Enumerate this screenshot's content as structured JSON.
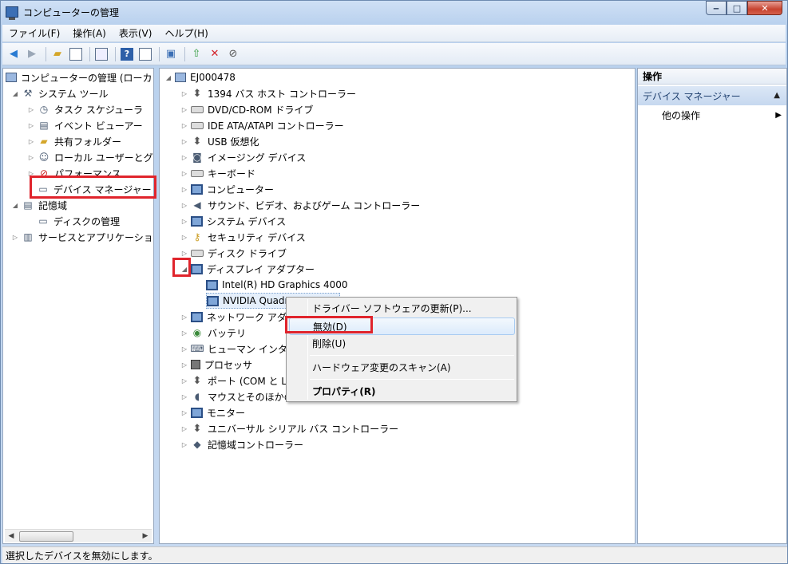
{
  "window": {
    "title": "コンピューターの管理",
    "minimize": "‒",
    "maximize": "□",
    "close": "✕"
  },
  "menubar": {
    "items": [
      "ファイル(F)",
      "操作(A)",
      "表示(V)",
      "ヘルプ(H)"
    ]
  },
  "left_tree": {
    "root": "コンピューターの管理 (ローカ",
    "system_tools": "システム ツール",
    "task_scheduler": "タスク スケジューラ",
    "event_viewer": "イベント ビューアー",
    "shared_folders": "共有フォルダー",
    "local_users": "ローカル ユーザーとグ",
    "performance": "パフォーマンス",
    "device_manager": "デバイス マネージャー",
    "storage": "記憶域",
    "disk_management": "ディスクの管理",
    "services_apps": "サービスとアプリケーショ"
  },
  "device_tree": {
    "computer_name": "EJ000478",
    "categories": [
      "1394 バス ホスト コントローラー",
      "DVD/CD-ROM ドライブ",
      "IDE ATA/ATAPI コントローラー",
      "USB 仮想化",
      "イメージング デバイス",
      "キーボード",
      "コンピューター",
      "サウンド、ビデオ、およびゲーム コントローラー",
      "システム デバイス",
      "セキュリティ デバイス",
      "ディスク ドライブ",
      "ディスプレイ アダプター"
    ],
    "display_children": [
      "Intel(R) HD Graphics 4000",
      "NVIDIA Quadro K1000M"
    ],
    "categories_after": [
      "ネットワーク アダプター",
      "バッテリ",
      "ヒューマン インターフェイス デバイス",
      "プロセッサ",
      "ポート (COM と LPT)",
      "マウスとそのほかのポインティング デバイス",
      "モニター",
      "ユニバーサル シリアル バス コントローラー",
      "記憶域コントローラー"
    ]
  },
  "context_menu": {
    "update_driver": "ドライバー ソフトウェアの更新(P)...",
    "disable": "無効(D)",
    "uninstall": "削除(U)",
    "scan": "ハードウェア変更のスキャン(A)",
    "properties": "プロパティ(R)"
  },
  "actions_pane": {
    "header": "操作",
    "section": "デバイス マネージャー",
    "other": "他の操作"
  },
  "statusbar": {
    "text": "選択したデバイスを無効にします。"
  },
  "colors": {
    "highlight_box": "#e0242c",
    "title_bg": "#c6d9f1"
  }
}
